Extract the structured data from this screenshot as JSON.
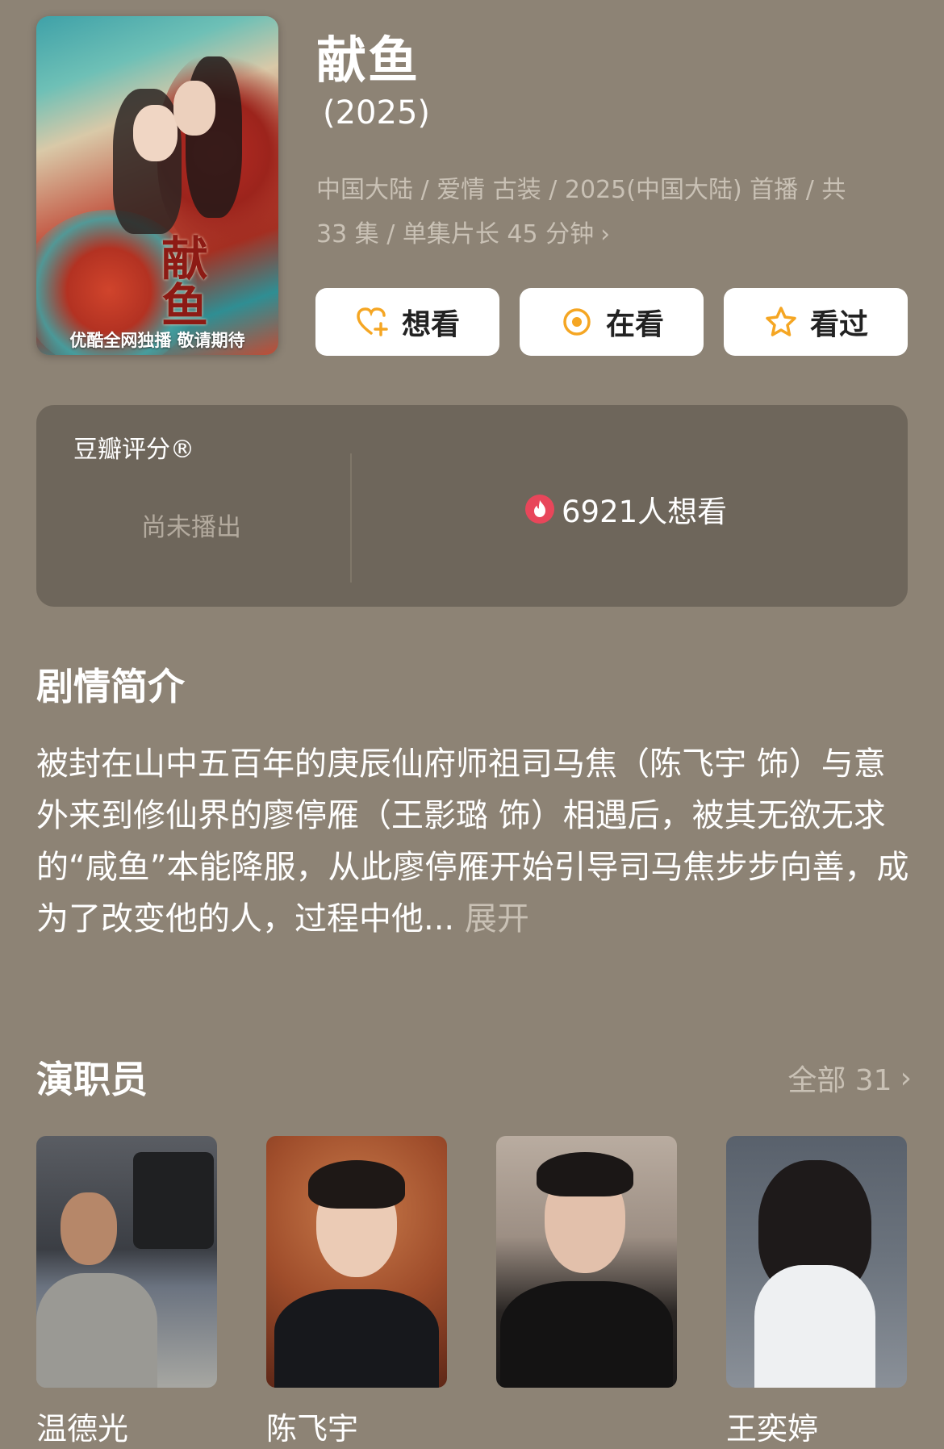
{
  "poster": {
    "calligraphy": "献鱼",
    "tagline": "优酷全网独播 敬请期待"
  },
  "title": "献鱼",
  "year": " (2025)",
  "meta_line1": "中国大陆 / 爱情 古装 / 2025(中国大陆) 首播 / 共",
  "meta_line2": "33 集 / 单集片长 45 分钟",
  "actions": {
    "want": "想看",
    "watching": "在看",
    "watched": "看过"
  },
  "rating": {
    "title": "豆瓣评分®",
    "status": "尚未播出",
    "want_count": "6921人想看"
  },
  "synopsis": {
    "heading": "剧情简介",
    "text": "被封在山中五百年的庚辰仙府师祖司马焦（陈飞宇 饰）与意外来到修仙界的廖停雁（王影璐 饰）相遇后，被其无欲无求的“咸鱼”本能降服，从此廖停雁开始引导司马焦步步向善，成为了改变他的人，过程中他...",
    "more": "展开"
  },
  "cast": {
    "heading": "演职员",
    "all_label": "全部 31",
    "members": [
      {
        "name": "温德光"
      },
      {
        "name": "陈飞宇"
      },
      {
        "name": ""
      },
      {
        "name": "王奕婷"
      }
    ]
  },
  "colors": {
    "background": "#8d8375",
    "card": "#6e665b",
    "accent_orange": "#f5a623",
    "fire_red": "#e8465a"
  }
}
